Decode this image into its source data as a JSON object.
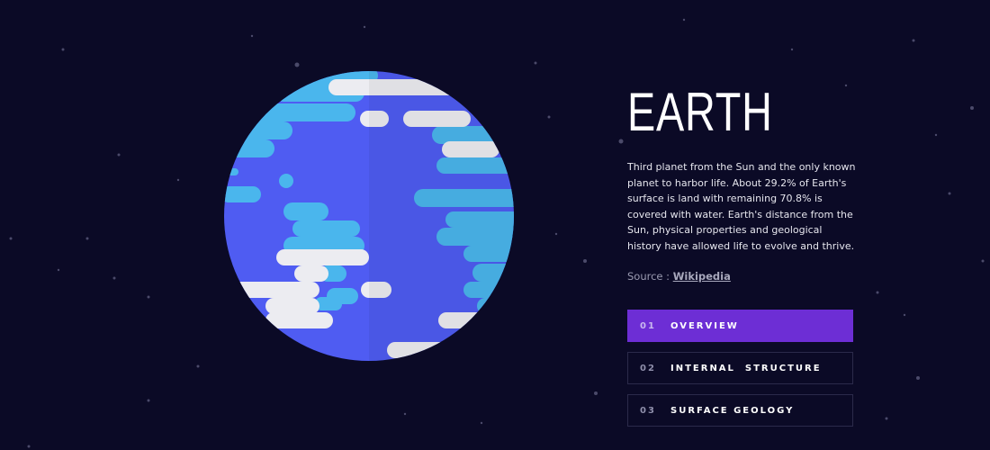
{
  "colors": {
    "background": "#0b0a26",
    "accent": "#6d2ed5",
    "planet_land_blue": "#4f5cf2",
    "planet_water": "#4ab6ed",
    "planet_clouds": "#ececf1",
    "tab_border": "#2b2a4a"
  },
  "planet": {
    "name": "EARTH",
    "description": "Third planet from the Sun and the only known planet to harbor life. About 29.2% of Earth's surface is land with remaining 70.8% is covered with water. Earth's distance from the Sun, physical properties and geological history have allowed life to evolve and thrive.",
    "source_prefix": "Source : ",
    "source_link": "Wikipedia",
    "illustration_icon": "earth-planet-illustration"
  },
  "tabs": [
    {
      "number": "01",
      "label": "OVERVIEW",
      "active": true
    },
    {
      "number": "02",
      "label": "INTERNAL  STRUCTURE",
      "active": false
    },
    {
      "number": "03",
      "label": "SURFACE GEOLOGY",
      "active": false
    }
  ]
}
